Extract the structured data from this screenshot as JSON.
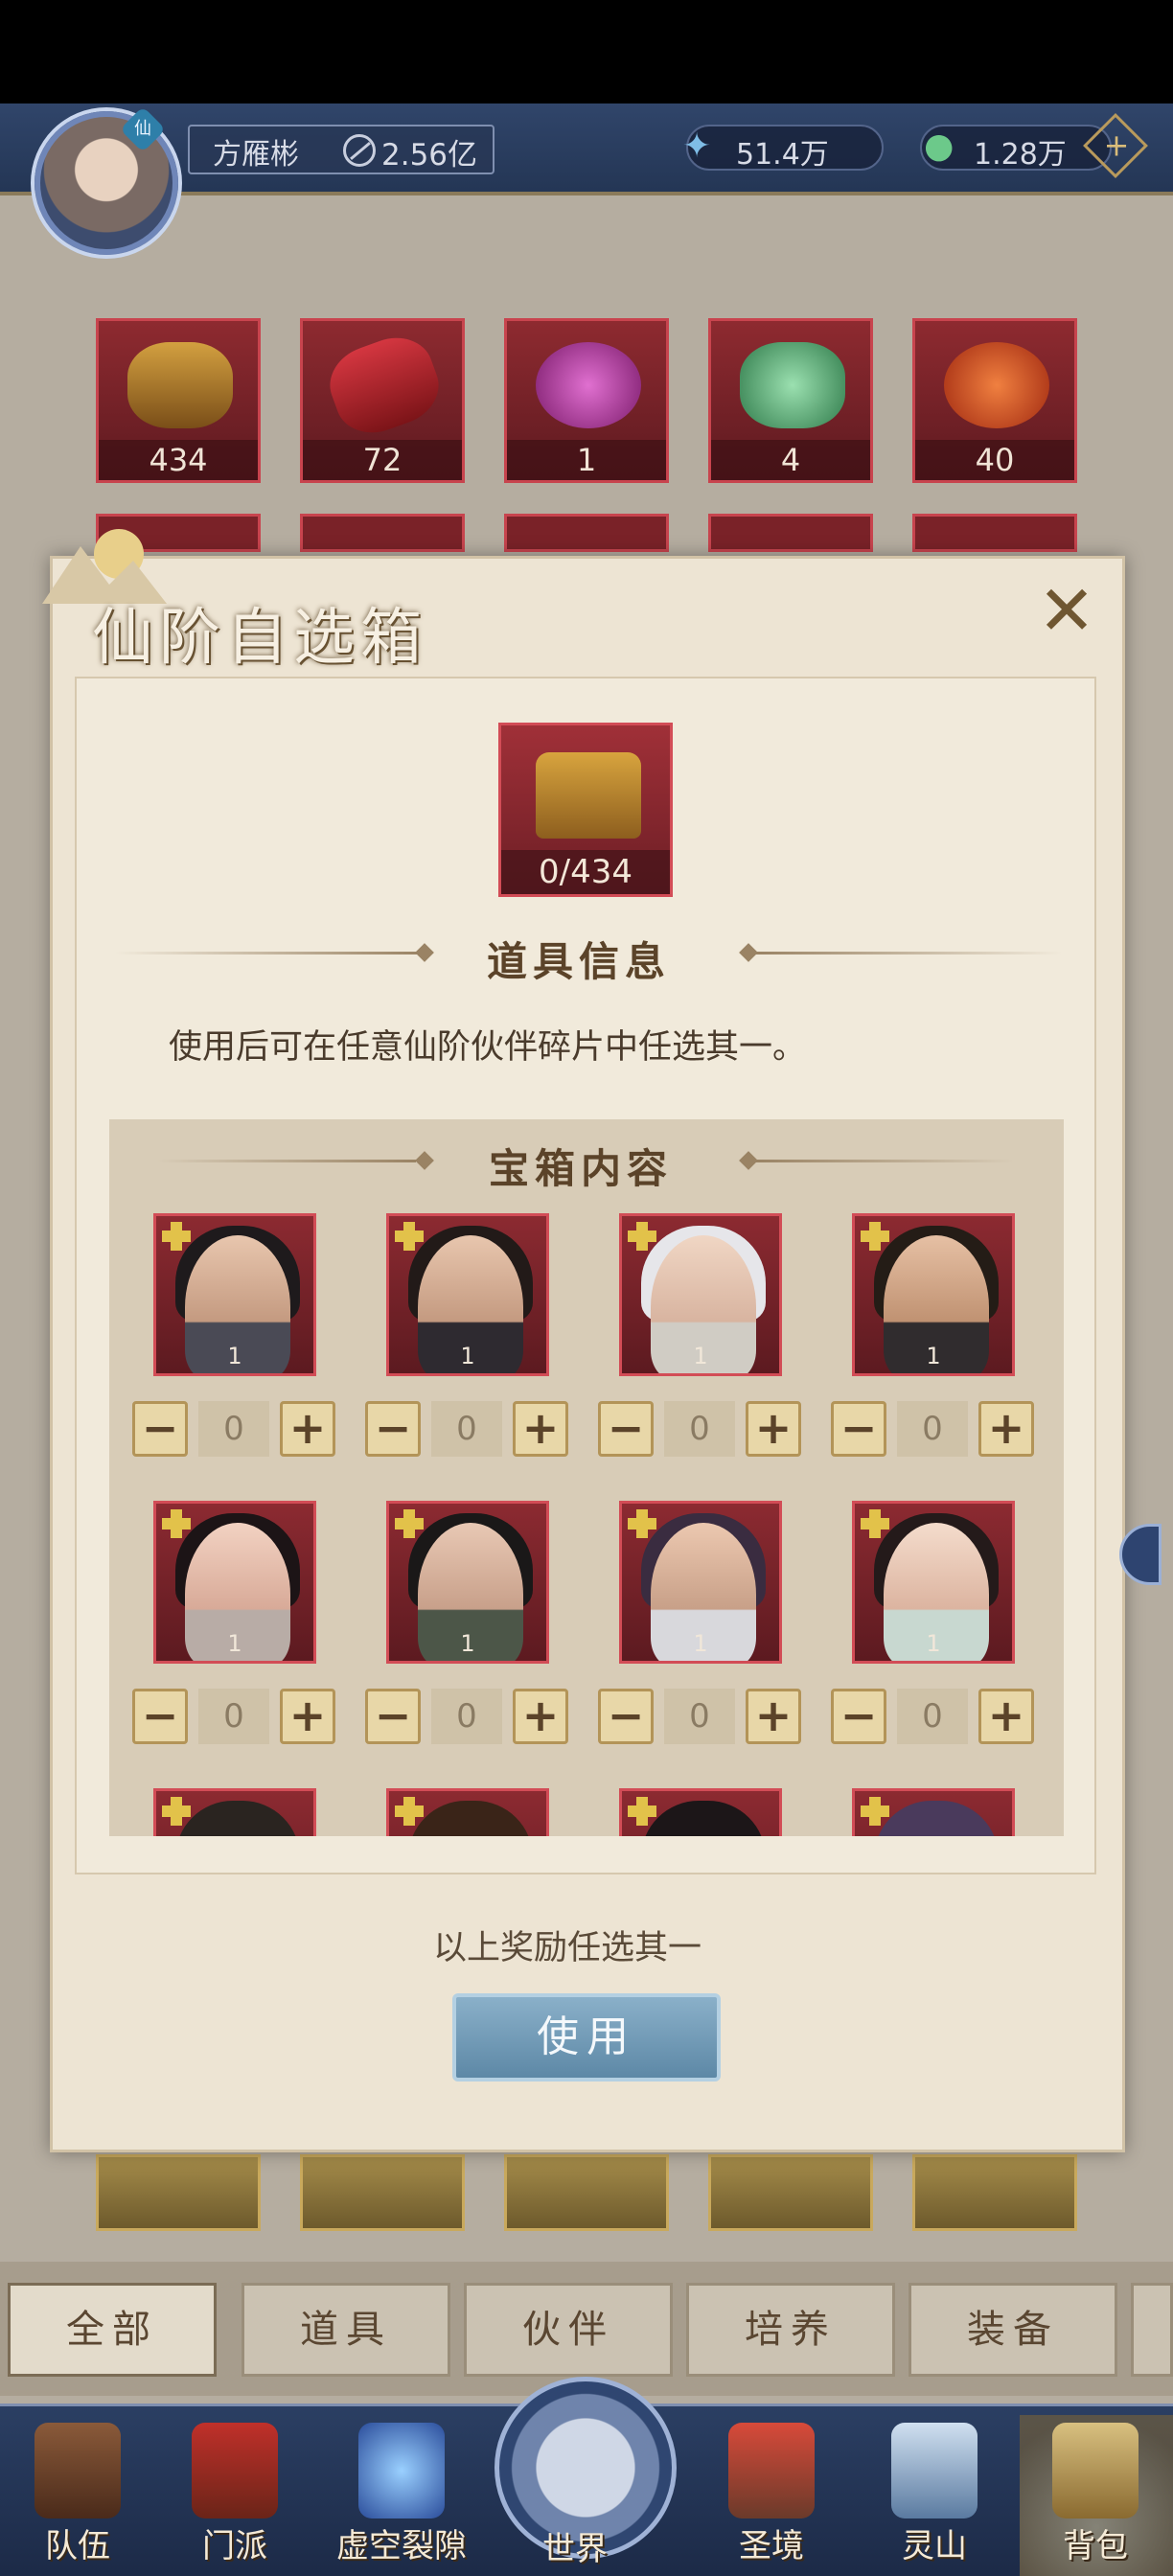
{
  "header": {
    "player_name": "方雁彬",
    "power_value": "2.56亿",
    "avatar_badge": "仙",
    "currency_crystal": "51.4万",
    "currency_jade": "1.28万",
    "add_label": "+"
  },
  "inventory": {
    "row1_counts": [
      "434",
      "72",
      "1",
      "4",
      "40"
    ]
  },
  "modal": {
    "title": "仙阶自选箱",
    "close_label": "✕",
    "item_count": "0/434",
    "info_title": "道具信息",
    "description": "使用后可在任意仙阶伙伴碎片中任选其一。",
    "contents_title": "宝箱内容",
    "cards": [
      {
        "num": "1",
        "value": "0"
      },
      {
        "num": "1",
        "value": "0"
      },
      {
        "num": "1",
        "value": "0"
      },
      {
        "num": "1",
        "value": "0"
      },
      {
        "num": "1",
        "value": "0"
      },
      {
        "num": "1",
        "value": "0"
      },
      {
        "num": "1",
        "value": "0"
      },
      {
        "num": "1",
        "value": "0"
      }
    ],
    "minus_label": "−",
    "plus_label": "+",
    "note": "以上奖励任选其一",
    "use_button": "使用"
  },
  "tabs": [
    "全部",
    "道具",
    "伙伴",
    "培养",
    "装备"
  ],
  "nav": [
    "队伍",
    "门派",
    "虚空裂隙",
    "世界",
    "圣境",
    "灵山",
    "背包"
  ],
  "colors": {
    "accent_red": "#8c2a31",
    "nav_blue": "#2b3f63",
    "use_button_blue": "#5d88a6"
  }
}
